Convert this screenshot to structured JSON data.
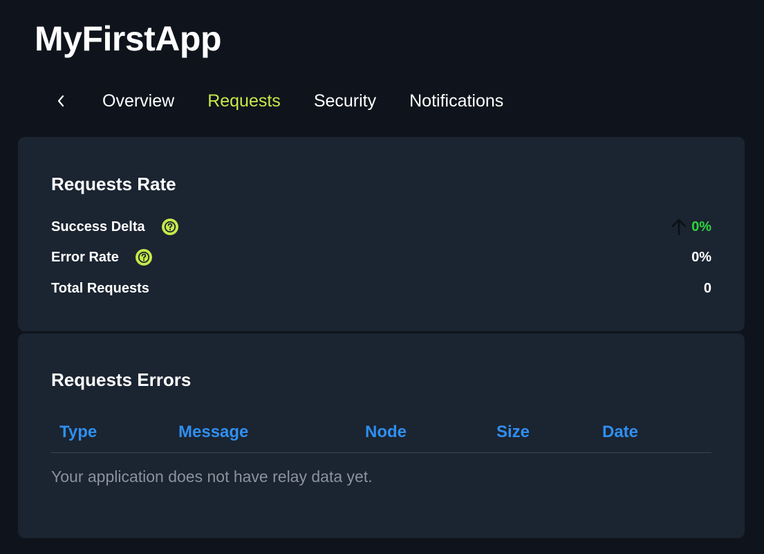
{
  "app": {
    "title": "MyFirstApp"
  },
  "tabs": [
    {
      "label": "Overview",
      "active": false
    },
    {
      "label": "Requests",
      "active": true
    },
    {
      "label": "Security",
      "active": false
    },
    {
      "label": "Notifications",
      "active": false
    }
  ],
  "icons": {
    "back": "chevron-left-icon",
    "help": "question-circle-icon",
    "trend": "arrow-up-icon"
  },
  "colors": {
    "background": "#0f141c",
    "card": "#1b2431",
    "active_tab": "#c5e94a",
    "help_icon": "#c5e94a",
    "positive": "#2fd33a",
    "table_header": "#2f8ff0",
    "muted_text": "#8a929c"
  },
  "requests_rate": {
    "title": "Requests Rate",
    "metrics": [
      {
        "label": "Success Delta",
        "value": "0%",
        "has_help": true,
        "trend": "up"
      },
      {
        "label": "Error Rate",
        "value": "0%",
        "has_help": true
      },
      {
        "label": "Total Requests",
        "value": "0",
        "has_help": false
      }
    ]
  },
  "requests_errors": {
    "title": "Requests Errors",
    "columns": [
      "Type",
      "Message",
      "Node",
      "Size",
      "Date"
    ],
    "empty_message": "Your application does not have relay data yet."
  }
}
